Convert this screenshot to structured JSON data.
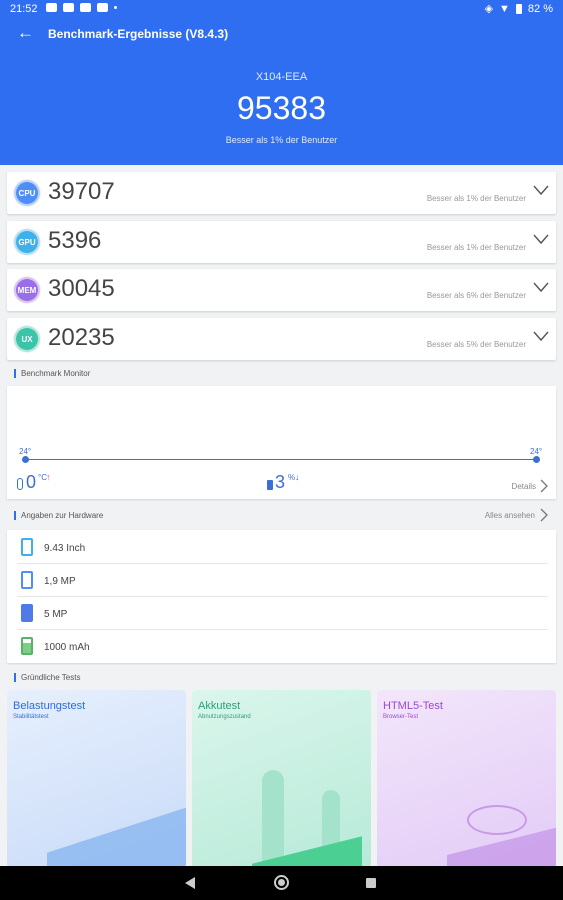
{
  "status_bar": {
    "time": "21:52",
    "battery": "82 %"
  },
  "toolbar": {
    "title": "Benchmark-Ergebnisse (V8.4.3)"
  },
  "summary": {
    "device": "X104-EEA",
    "total_score": "95383",
    "rank": "Besser als 1% der Benutzer"
  },
  "scores": [
    {
      "badge": "CPU",
      "color": "#4f8ef7",
      "value": "39707",
      "rank": "Besser als 1% der Benutzer"
    },
    {
      "badge": "GPU",
      "color": "#3fb0e8",
      "value": "5396",
      "rank": "Besser als 1% der Benutzer"
    },
    {
      "badge": "MEM",
      "color": "#9a6ee6",
      "value": "30045",
      "rank": "Besser als 6% der Benutzer"
    },
    {
      "badge": "UX",
      "color": "#3cc4a8",
      "value": "20235",
      "rank": "Besser als 5% der Benutzer"
    }
  ],
  "monitor": {
    "title": "Benchmark Monitor",
    "start_temp": "24°",
    "end_temp": "24°",
    "temp_change": "0",
    "temp_unit": "°C",
    "temp_arrow": "↑",
    "battery_change": "3",
    "battery_unit": "%",
    "battery_arrow": "↓",
    "details": "Details"
  },
  "hardware": {
    "title": "Angaben zur Hardware",
    "view_all": "Alles ansehen",
    "items": [
      {
        "icon": "screen-icon",
        "text": "9.43 Inch"
      },
      {
        "icon": "front-camera-icon",
        "text": "1,9 MP"
      },
      {
        "icon": "rear-camera-icon",
        "text": "5 MP"
      },
      {
        "icon": "battery-icon",
        "text": "1000 mAh"
      }
    ]
  },
  "tests": {
    "title": "Gründliche Tests",
    "items": [
      {
        "title": "Belastungstest",
        "subtitle": "Stabilitätstest"
      },
      {
        "title": "Akkutest",
        "subtitle": "Abnutzungszustand"
      },
      {
        "title": "HTML5-Test",
        "subtitle": "Browser-Test"
      }
    ]
  }
}
